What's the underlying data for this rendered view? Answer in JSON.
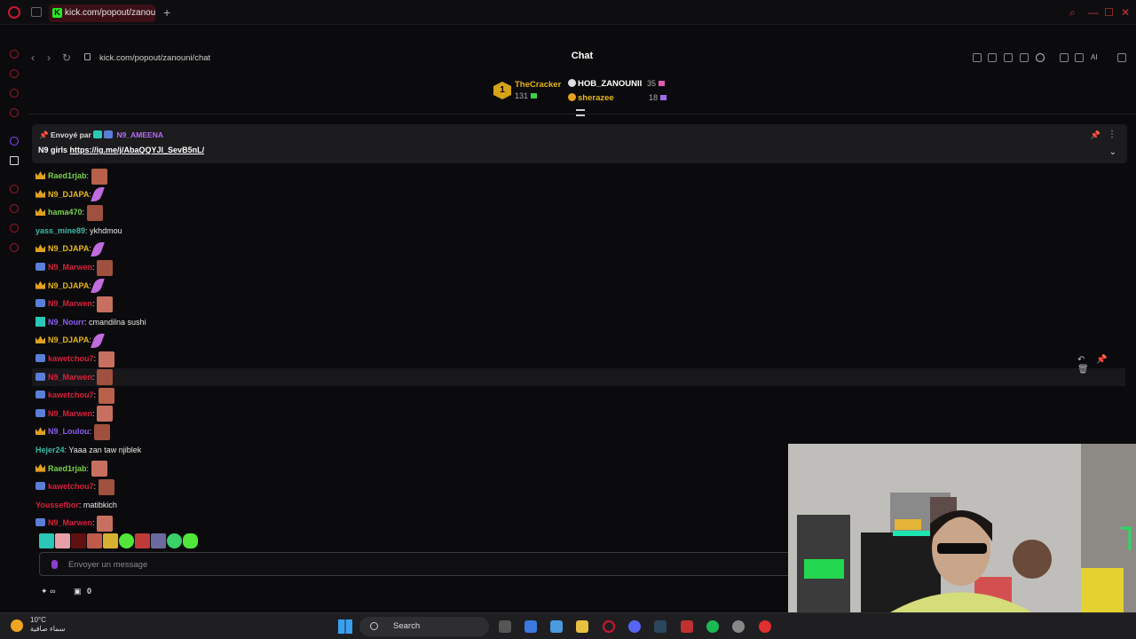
{
  "browser": {
    "tab_title": "kick.com/popout/zanouni/",
    "tab_favicon": "K",
    "url": "kick.com/popout/zanouni/chat",
    "accent": "#d11530"
  },
  "chat": {
    "title": "Chat",
    "leaderboard": {
      "rank": "1",
      "gifters": [
        {
          "name": "TheCracker",
          "count": "131",
          "color": "#e8b61c"
        },
        {
          "name": "HOB_ZANOUNII",
          "count": "35",
          "color": "#ffffff"
        },
        {
          "name": "sherazee",
          "count": "18",
          "color": "#e8b61c"
        }
      ]
    },
    "pinned": {
      "sent_by_label": "Envoyé par",
      "sender": "N9_AMEENA",
      "prefix": "N9 girls",
      "link": "https://ig.me/j/AbaQQYJl_SevB5nL/"
    },
    "messages": [
      {
        "user": "Raed1rjab",
        "color": "#7ad14a",
        "badge": "crown",
        "emote": true,
        "text": ""
      },
      {
        "user": "N9_DJAPA",
        "color": "#e8b61c",
        "badge": "crown",
        "feather": true,
        "text": ""
      },
      {
        "user": "hama470",
        "color": "#7ad14a",
        "badge": "crown",
        "emote": true,
        "text": ""
      },
      {
        "user": "yass_mine89",
        "color": "#3fb8a8",
        "badge": "",
        "text": "ykhdmou"
      },
      {
        "user": "N9_DJAPA",
        "color": "#e8b61c",
        "badge": "crown",
        "feather": true,
        "text": ""
      },
      {
        "user": "N9_Marwen",
        "color": "#d8203a",
        "badge": "n9",
        "emote": true,
        "text": ""
      },
      {
        "user": "N9_DJAPA",
        "color": "#e8b61c",
        "badge": "crown",
        "feather": true,
        "text": ""
      },
      {
        "user": "N9_Marwen",
        "color": "#d8203a",
        "badge": "n9",
        "emote": true,
        "text": ""
      },
      {
        "user": "N9_Nourr",
        "color": "#8b5cf0",
        "badge": "sub",
        "text": "cmandilna sushi"
      },
      {
        "user": "N9_DJAPA",
        "color": "#e8b61c",
        "badge": "crown",
        "feather": true,
        "text": ""
      },
      {
        "user": "kawetchou7",
        "color": "#d8203a",
        "badge": "n9",
        "emote": true,
        "text": ""
      },
      {
        "user": "N9_Marwen",
        "color": "#d8203a",
        "badge": "n9",
        "emote": true,
        "text": "",
        "highlight": true
      },
      {
        "user": "kawetchou7",
        "color": "#d8203a",
        "badge": "n9",
        "emote": true,
        "text": ""
      },
      {
        "user": "N9_Marwen",
        "color": "#d8203a",
        "badge": "n9",
        "emote": true,
        "text": ""
      },
      {
        "user": "N9_Loulou",
        "color": "#8b5cf0",
        "badge": "crown",
        "emote": true,
        "text": ""
      },
      {
        "user": "Hejer24",
        "color": "#3fb8a8",
        "badge": "",
        "text": "Yaaa zan taw njiblek"
      },
      {
        "user": "Raed1rjab",
        "color": "#7ad14a",
        "badge": "crown",
        "emote": true,
        "text": ""
      },
      {
        "user": "kawetchou7",
        "color": "#d8203a",
        "badge": "n9",
        "emote": true,
        "text": ""
      },
      {
        "user": "Youssefbor",
        "color": "#d8203a",
        "badge": "",
        "text": "matibkich"
      },
      {
        "user": "N9_Marwen",
        "color": "#d8203a",
        "badge": "n9",
        "emote": true,
        "text": ""
      }
    ],
    "input_placeholder": "Envoyer un message",
    "bottom_count": "0"
  },
  "taskbar": {
    "temperature": "10°C",
    "weather_desc": "سماء صافية",
    "search_label": "Search"
  }
}
